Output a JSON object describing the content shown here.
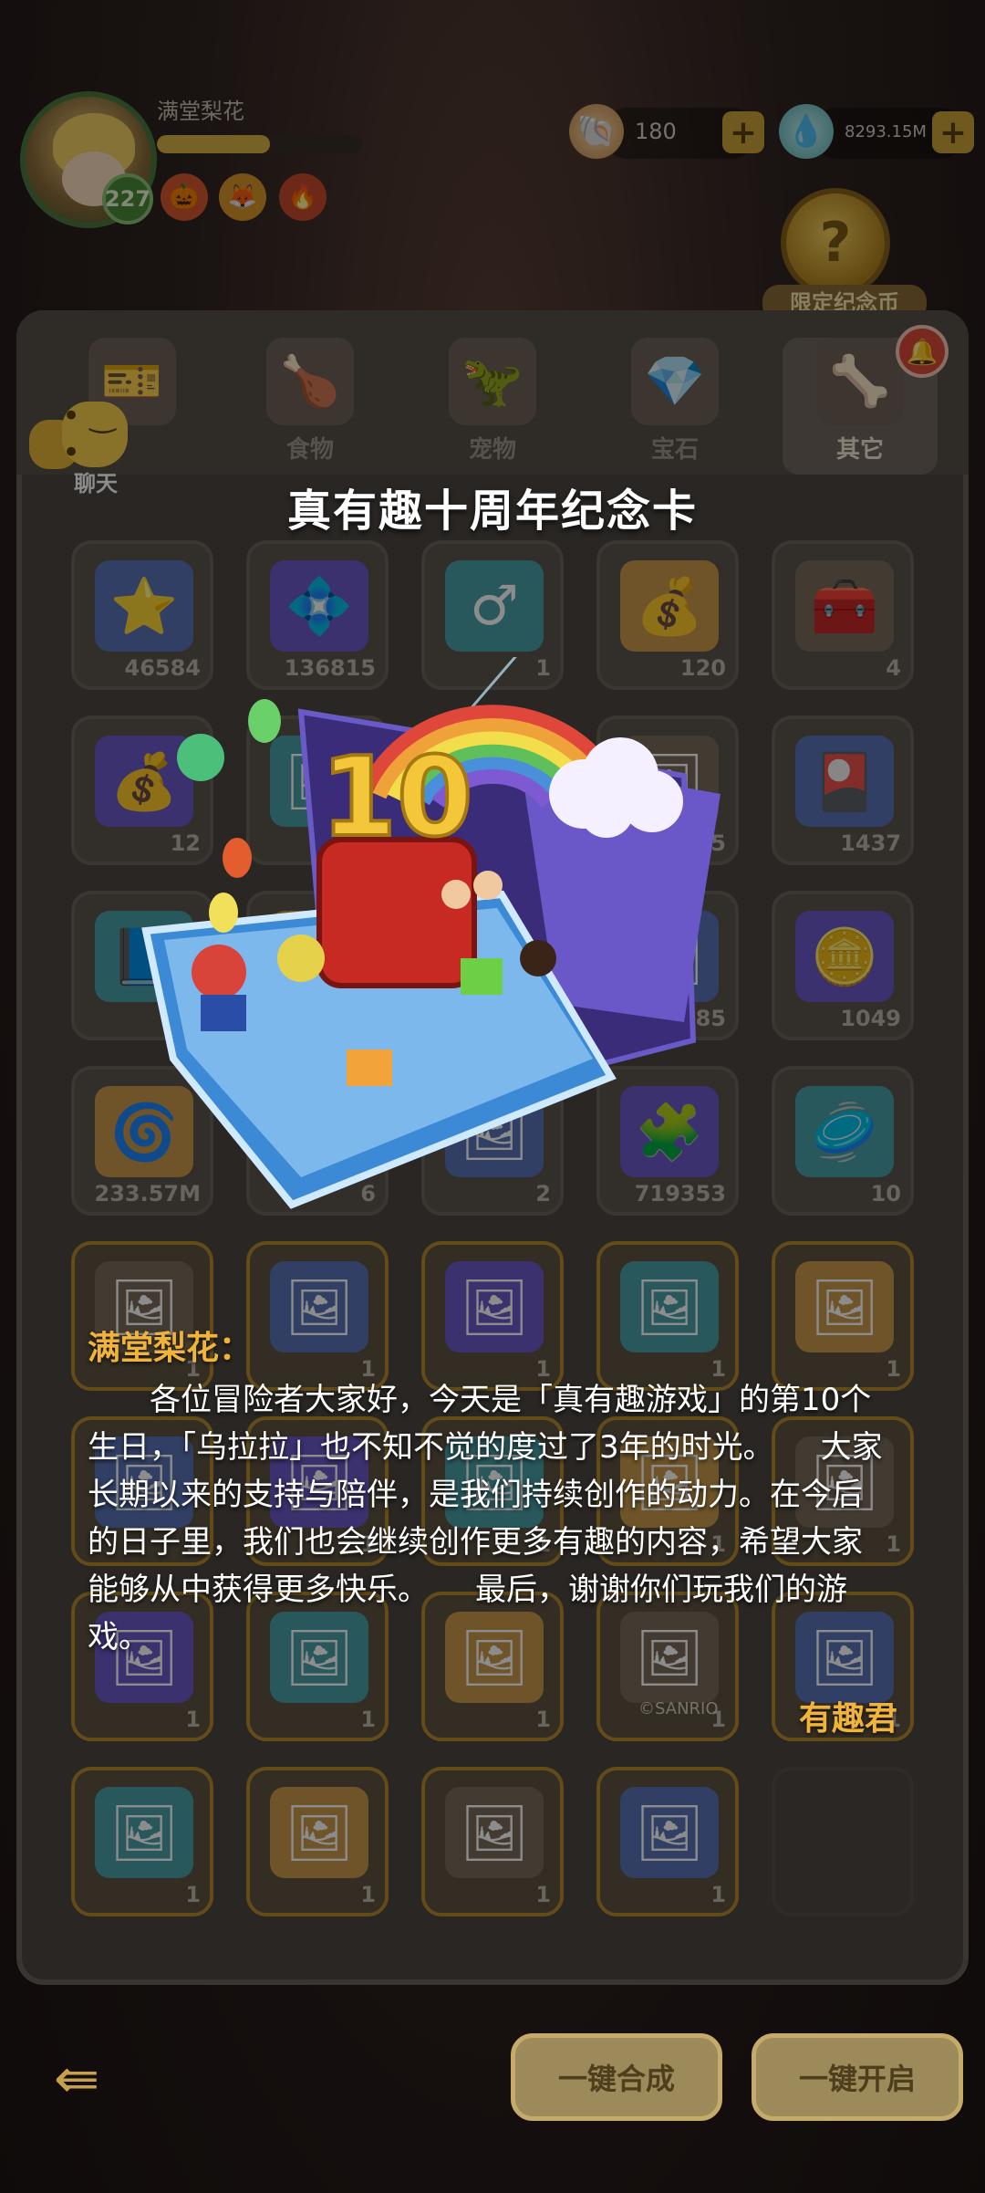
{
  "hud": {
    "player_name": "满堂梨花",
    "level": "227",
    "xp_fraction": 0.55,
    "currency_1": {
      "icon": "snail-shell-icon",
      "value": "180"
    },
    "currency_2": {
      "icon": "slime-gem-icon",
      "value": "8293.15M"
    },
    "plus_label": "+",
    "limited_coin_label": "限定纪念币"
  },
  "tabs": [
    {
      "label": "",
      "icon": "ticket-icon"
    },
    {
      "label": "食物",
      "icon": "food-bowl-icon"
    },
    {
      "label": "宠物",
      "icon": "pet-icon"
    },
    {
      "label": "宝石",
      "icon": "gem-icon"
    },
    {
      "label": "其它",
      "icon": "bone-icon"
    }
  ],
  "chat_label": "聊天",
  "grid": {
    "rows": [
      [
        "46584",
        "136815",
        "1",
        "120",
        "4"
      ],
      [
        "12",
        "",
        "",
        "5",
        "1437"
      ],
      [
        "",
        "",
        "",
        "6885",
        "1049"
      ],
      [
        "233.57M",
        "6",
        "2",
        "719353",
        "10"
      ],
      [
        "1",
        "1",
        "1",
        "1",
        "1"
      ],
      [
        "1",
        "1",
        "1",
        "1",
        "1"
      ],
      [
        "1",
        "1",
        "1",
        "1",
        "1"
      ],
      [
        "1",
        "1",
        "1",
        "1",
        ""
      ]
    ],
    "watermark": "©SANRIO"
  },
  "modal": {
    "title": "真有趣十周年纪念卡",
    "card_number": "10",
    "sender": "满堂梨花：",
    "body": "各位冒险者大家好，今天是「真有趣游戏」的第10个生日，「乌拉拉」也不知不觉的度过了3年的时光。　　大家长期以来的支持与陪伴，是我们持续创作的动力。在今后的日子里，我们也会继续创作更多有趣的内容，希望大家能够从中获得更多快乐。　　最后，谢谢你们玩我们的游戏。",
    "signature": "有趣君"
  },
  "bottom": {
    "merge_label": "一键合成",
    "open_label": "一键开启"
  },
  "colors": {
    "accent_gold": "#f1b43b",
    "panel": "#4c4640",
    "level_green": "#4b8a3a"
  }
}
